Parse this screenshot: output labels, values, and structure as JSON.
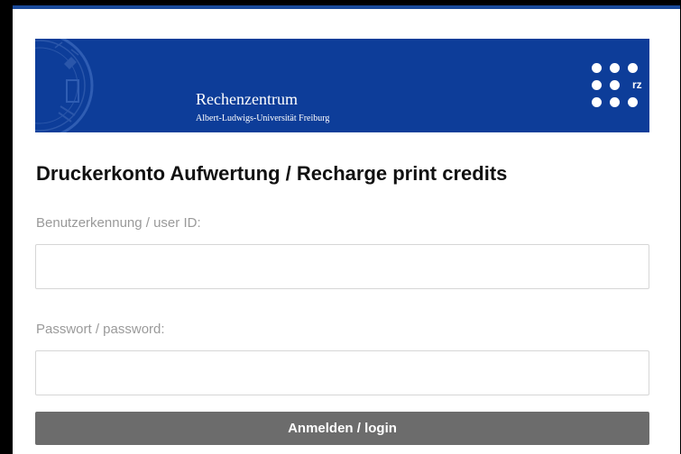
{
  "banner": {
    "title": "Rechenzentrum",
    "subtitle": "Albert-Ludwigs-Universität Freiburg",
    "logo_text": "rz",
    "seal_icon": "university-seal-icon",
    "background_color": "#0d3d99"
  },
  "page": {
    "heading": "Druckerkonto Aufwertung / Recharge print credits"
  },
  "form": {
    "user_id": {
      "label": "Benutzerkennung / user ID:",
      "value": "",
      "placeholder": ""
    },
    "password": {
      "label": "Passwort / password:",
      "value": "",
      "placeholder": ""
    },
    "login_label": "Anmelden / login",
    "button_color": "#6c6c6c"
  }
}
